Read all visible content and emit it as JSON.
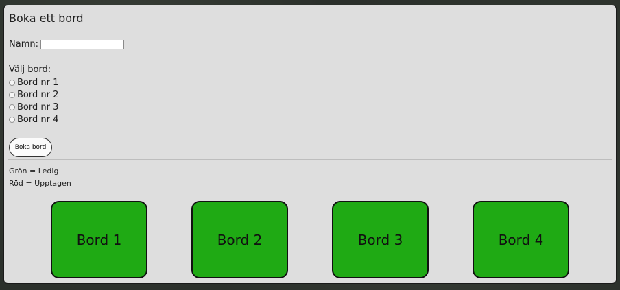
{
  "form": {
    "title": "Boka ett bord",
    "name_label": "Namn:",
    "name_value": "",
    "choose_label": "Välj bord:",
    "options": [
      {
        "label": "Bord nr 1",
        "checked": false
      },
      {
        "label": "Bord nr 2",
        "checked": false
      },
      {
        "label": "Bord nr 3",
        "checked": false
      },
      {
        "label": "Bord nr 4",
        "checked": false
      }
    ],
    "submit_label": "Boka bord"
  },
  "legend": {
    "green": "Grön = Ledig",
    "red": "Röd = Upptagen"
  },
  "tables": [
    {
      "label": "Bord 1",
      "status": "free"
    },
    {
      "label": "Bord 2",
      "status": "free"
    },
    {
      "label": "Bord 3",
      "status": "free"
    },
    {
      "label": "Bord 4",
      "status": "free"
    }
  ],
  "colors": {
    "free": "#1faa14",
    "occupied": "#d12a1e",
    "panel": "#dedede"
  }
}
